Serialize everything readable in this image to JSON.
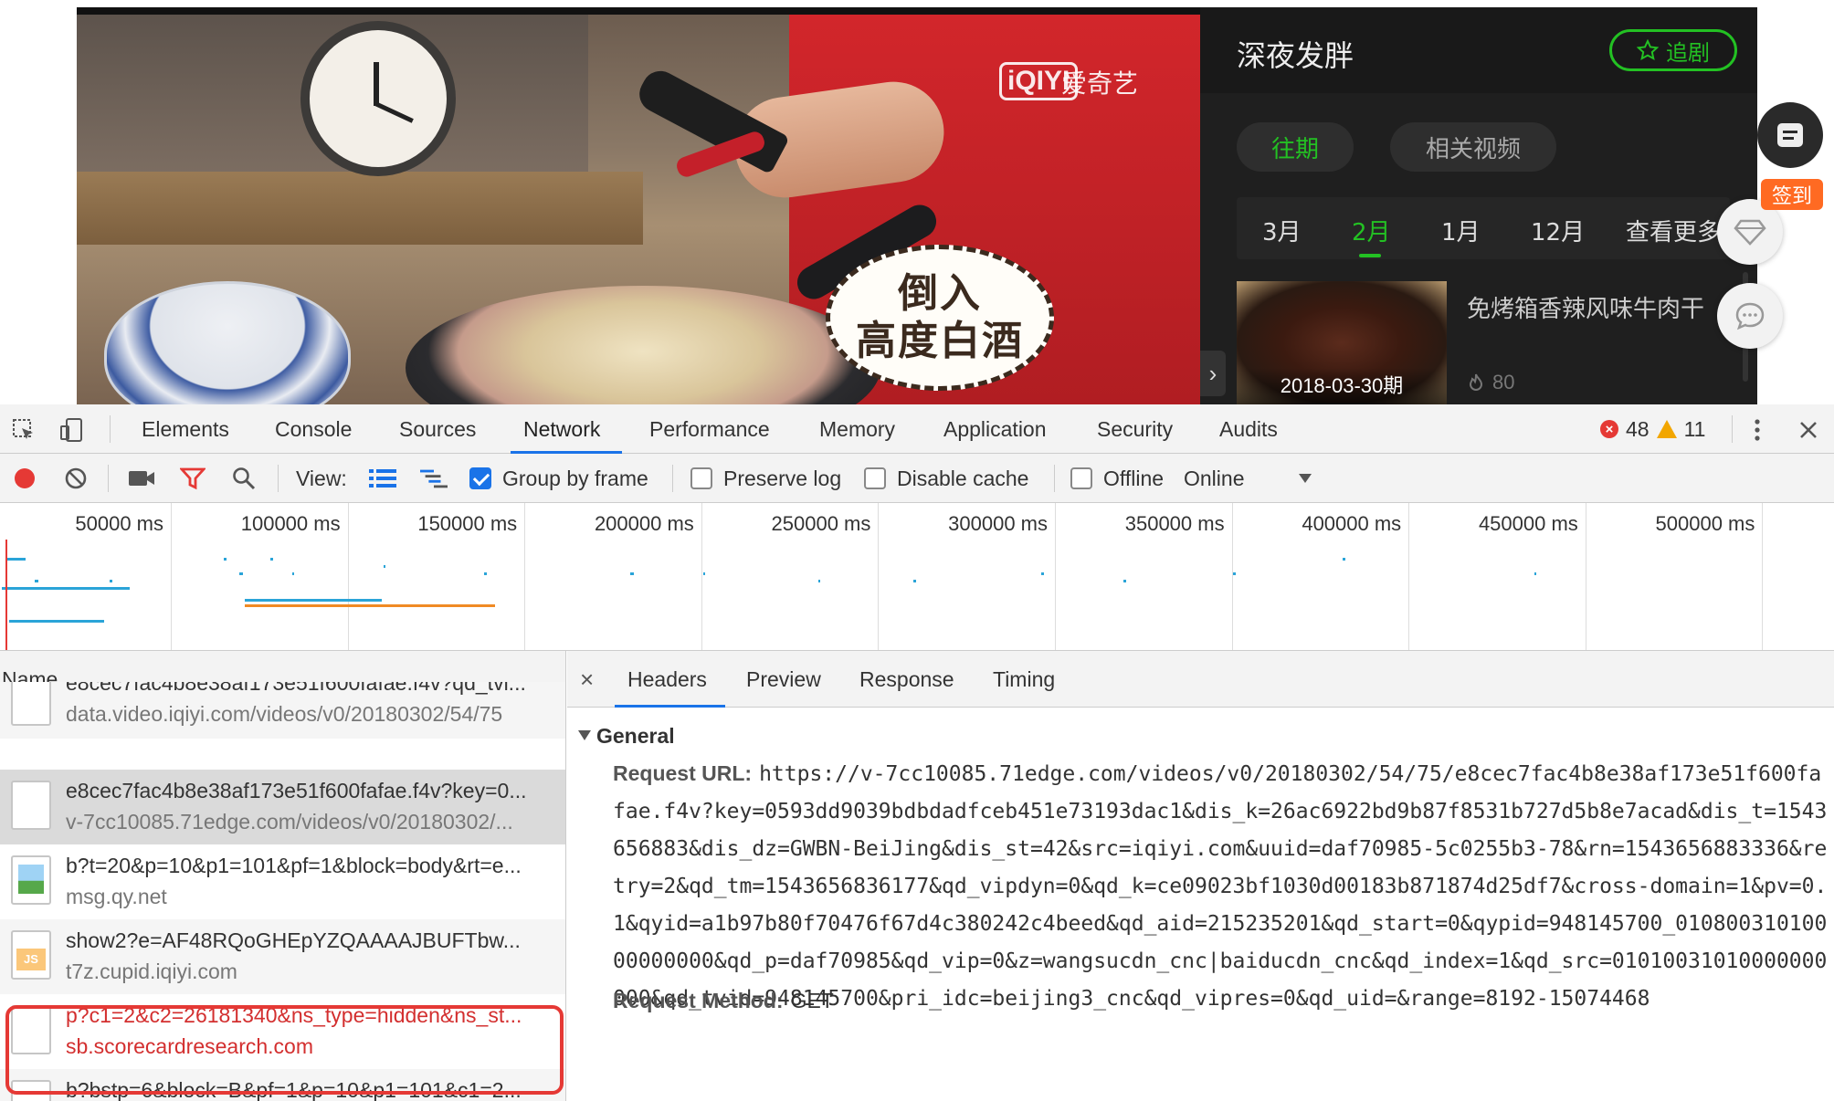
{
  "site": {
    "video_logo": "iQIYI",
    "video_logo_cn": "爱奇艺",
    "subtitle_line1": "倒入",
    "subtitle_line2": "高度白酒",
    "show_title": "深夜发胖",
    "follow_button": "追剧",
    "tabs": [
      "往期",
      "相关视频"
    ],
    "months": [
      "3月",
      "2月",
      "1月",
      "12月",
      "查看更多"
    ],
    "active_month": "2月",
    "episode": {
      "title": "免烤箱香辣风味牛肉干",
      "date": "2018-03-30期",
      "views": "80"
    },
    "checkin_badge": "签到",
    "accent_color": "#23c123"
  },
  "devtools": {
    "tabs": [
      "Elements",
      "Console",
      "Sources",
      "Network",
      "Performance",
      "Memory",
      "Application",
      "Security",
      "Audits"
    ],
    "active_tab": "Network",
    "error_count": "48",
    "warning_count": "11",
    "toolbar": {
      "view_label": "View:",
      "group_by_frame": "Group by frame",
      "group_by_frame_checked": true,
      "preserve_log": "Preserve log",
      "disable_cache": "Disable cache",
      "offline": "Offline",
      "throttle": "Online"
    },
    "timeline_ticks": [
      "50000 ms",
      "100000 ms",
      "150000 ms",
      "200000 ms",
      "250000 ms",
      "300000 ms",
      "350000 ms",
      "400000 ms",
      "450000 ms",
      "500000 ms",
      "5"
    ],
    "name_header": "Name",
    "requests": [
      {
        "name": "e8cec7fac4b8e38af173e51f600fafae.f4v?qd_tvi...",
        "domain": "data.video.iqiyi.com/videos/v0/20180302/54/75",
        "icon": "doc",
        "style": "alt"
      },
      {
        "name": "e8cec7fac4b8e38af173e51f600fafae.f4v?key=0...",
        "domain": "v-7cc10085.71edge.com/videos/v0/20180302/...",
        "icon": "doc",
        "style": "selected"
      },
      {
        "name": "b?t=20&p=10&p1=101&pf=1&block=body&rt=e...",
        "domain": "msg.qy.net",
        "icon": "img",
        "style": ""
      },
      {
        "name": "show2?e=AF48RQoGHEpYZQAAAAJBUFTbw...",
        "domain": "t7z.cupid.iqiyi.com",
        "icon": "js",
        "style": "alt"
      },
      {
        "name": "p?c1=2&c2=26181340&ns_type=hidden&ns_st...",
        "domain": "sb.scorecardresearch.com",
        "icon": "doc",
        "style": "red"
      },
      {
        "name": "b?bstp=6&block=B&pf=1&p=10&p1=101&c1=2...",
        "domain": "",
        "icon": "doc",
        "style": "alt"
      }
    ],
    "detail_tabs": [
      "Headers",
      "Preview",
      "Response",
      "Timing"
    ],
    "active_detail_tab": "Headers",
    "general_label": "General",
    "request_url_label": "Request URL:",
    "request_url": "https://v-7cc10085.71edge.com/videos/v0/20180302/54/75/e8cec7fac4b8e38af173e51f600fafae.f4v?key=0593dd9039bdbdadfceb451e73193dac1&dis_k=26ac6922bd9b87f8531b727d5b8e7acad&dis_t=1543656883&dis_dz=GWBN-BeiJing&dis_st=42&src=iqiyi.com&uuid=daf70985-5c0255b3-78&rn=1543656883336&retry=2&qd_tm=1543656836177&qd_vipdyn=0&qd_k=ce09023bf1030d00183b871874d25df7&cross-domain=1&pv=0.1&qyid=a1b97b80f70476f67d4c380242c4beed&qd_aid=215235201&qd_start=0&qypid=948145700_01080031010000000000&qd_p=daf70985&qd_vip=0&z=wangsucdn_cnc|baiducdn_cnc&qd_index=1&qd_src=01010031010000000000&qd_tvid=948145700&pri_idc=beijing3_cnc&qd_vipres=0&qd_uid=&range=8192-15074468",
    "request_method_label": "Request Method:",
    "request_method": "GET"
  }
}
